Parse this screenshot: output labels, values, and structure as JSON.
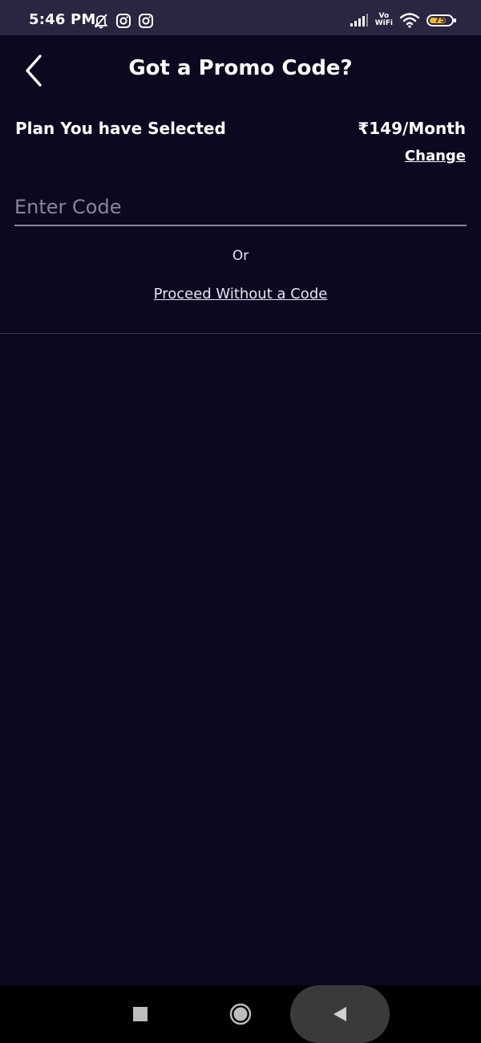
{
  "status_bar": {
    "time": "5:46 PM",
    "icons": [
      "bell-off-icon",
      "instagram-icon",
      "instagram-icon",
      "signal-icon",
      "vowifi-label",
      "wifi-icon",
      "battery-icon"
    ],
    "vowifi_top": "Vo",
    "vowifi_bottom": "WiFi",
    "battery_level": 75,
    "battery_text": "75",
    "battery_color": "#f5b92e"
  },
  "header": {
    "title": "Got a Promo Code?",
    "back_icon": "chevron-left-icon"
  },
  "plan": {
    "label": "Plan You have Selected",
    "price": "₹149/Month",
    "change_label": "Change"
  },
  "promo": {
    "placeholder": "Enter Code",
    "value": "",
    "or_text": "Or",
    "proceed_label": "Proceed Without a Code"
  },
  "nav_bar": {
    "icons": [
      "square-icon",
      "circle-icon",
      "triangle-back-icon"
    ]
  },
  "colors": {
    "background": "#0b0820",
    "status_bar": "#2a2540",
    "input_line": "#8a869a"
  }
}
